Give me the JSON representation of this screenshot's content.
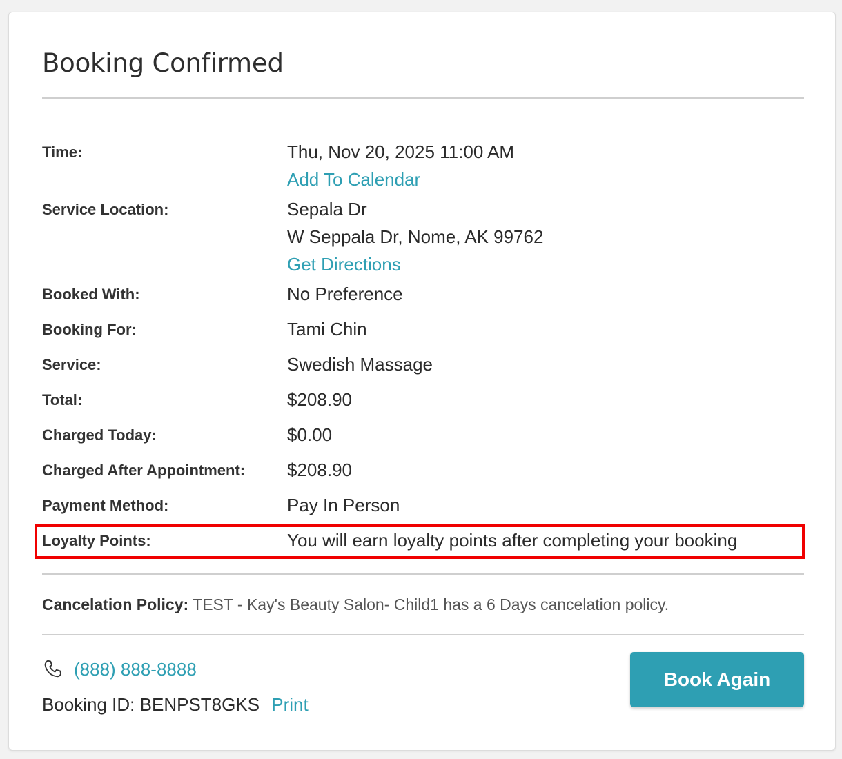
{
  "card": {
    "title": "Booking Confirmed"
  },
  "details": {
    "time": {
      "label": "Time:",
      "value": "Thu, Nov 20, 2025 11:00 AM",
      "link": "Add To Calendar"
    },
    "location": {
      "label": "Service Location:",
      "name": "Sepala Dr",
      "address": "W Seppala Dr, Nome, AK 99762",
      "link": "Get Directions"
    },
    "booked_with": {
      "label": "Booked With:",
      "value": "No Preference"
    },
    "booking_for": {
      "label": "Booking For:",
      "value": "Tami Chin"
    },
    "service": {
      "label": "Service:",
      "value": "Swedish Massage"
    },
    "total": {
      "label": "Total:",
      "value": "$208.90"
    },
    "charged_today": {
      "label": "Charged Today:",
      "value": "$0.00"
    },
    "charged_after": {
      "label": "Charged After Appointment:",
      "value": "$208.90"
    },
    "payment_method": {
      "label": "Payment Method:",
      "value": "Pay In Person"
    },
    "loyalty": {
      "label": "Loyalty Points:",
      "value": "You will earn loyalty points after completing your booking"
    }
  },
  "policy": {
    "label": "Cancelation Policy:",
    "text": "TEST - Kay's Beauty Salon- Child1 has a 6 Days cancelation policy."
  },
  "footer": {
    "phone_icon": "phone-icon",
    "phone": "(888) 888-8888",
    "booking_id_label": "Booking ID:",
    "booking_id": "BENPST8GKS",
    "print_label": "Print",
    "book_again_label": "Book Again"
  },
  "colors": {
    "accent": "#2e9fb3",
    "highlight": "#f00000"
  }
}
